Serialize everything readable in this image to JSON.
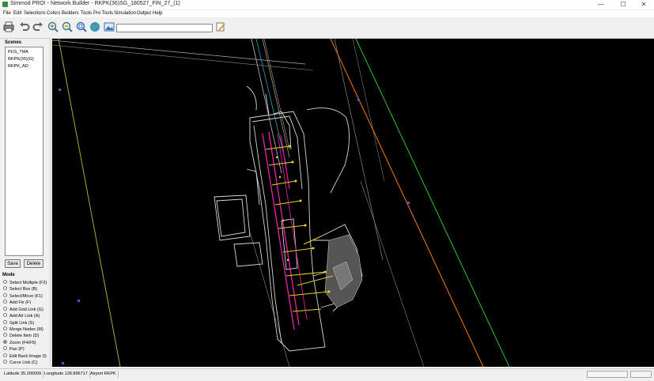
{
  "window": {
    "title": "Simmod PRO! - Network Builder - RKPK(36)SG_180527_FIN_27_(1)",
    "minimize": "—",
    "maximize": "☐",
    "close": "✕"
  },
  "menu": [
    "File",
    "Edit",
    "Selections",
    "Colors",
    "Builders",
    "Tools",
    "Pro Tools",
    "Simulation",
    "Output",
    "Help"
  ],
  "toolbar": {
    "icons": [
      "print-icon",
      "undo-icon",
      "redo-icon",
      "zoom-in-icon",
      "zoom-out-icon",
      "zoom-fit-icon",
      "globe-icon",
      "image-icon",
      "edit-icon"
    ],
    "search_value": ""
  },
  "scenes": {
    "label": "Scenes",
    "items": [
      "PUS_TMA",
      "RKPK(36)(G)",
      "RKPK_AD"
    ],
    "save_label": "Save",
    "delete_label": "Delete"
  },
  "mode": {
    "label": "Mode",
    "items": [
      {
        "label": "Select Multiple (F2)",
        "selected": false
      },
      {
        "label": "Select Box (B)",
        "selected": false
      },
      {
        "label": "Select/Move (F1)",
        "selected": false
      },
      {
        "label": "Add Fix (F)",
        "selected": false
      },
      {
        "label": "Add Grid Link (G)",
        "selected": false
      },
      {
        "label": "Add Air Link (A)",
        "selected": false
      },
      {
        "label": "Split Link (S)",
        "selected": false
      },
      {
        "label": "Merge Nodes (M)",
        "selected": false
      },
      {
        "label": "Delete Item (D)",
        "selected": false
      },
      {
        "label": "Zoom (F4/F5)",
        "selected": true
      },
      {
        "label": "Pan (P)",
        "selected": false
      },
      {
        "label": "Edit Back Image (I)",
        "selected": false
      },
      {
        "label": "Curve Link (C)",
        "selected": false
      }
    ]
  },
  "status": {
    "latitude": "Latitude 35.206909",
    "longitude": "Longitude 128.896717",
    "airport": "Airport RKPK"
  },
  "colors": {
    "canvas_bg": "#000000",
    "runway_magenta": "#e0209a",
    "taxiway_yellow": "#e8d020",
    "orange_line": "#d06a10",
    "green_line": "#30c030"
  }
}
